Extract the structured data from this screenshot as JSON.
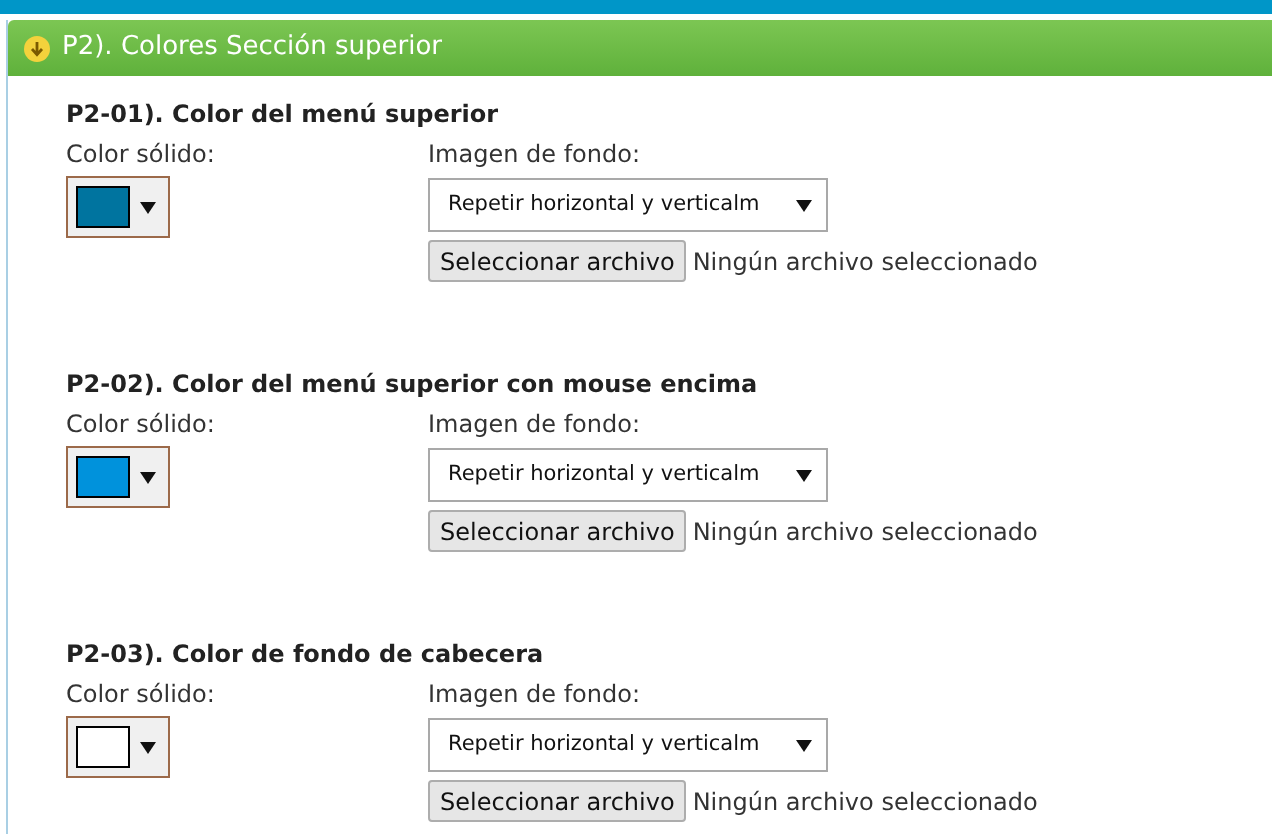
{
  "panel": {
    "title": "P2). Colores Sección superior",
    "expanded": true
  },
  "settings": [
    {
      "title": "P2-01). Color del menú superior",
      "color_label": "Color sólido:",
      "color": "#00749f",
      "image_label": "Imagen de fondo:",
      "repeat": "Repetir horizontal y verticalm",
      "file_button": "Seleccionar archivo",
      "file_status": "Ningún archivo seleccionado"
    },
    {
      "title": "P2-02). Color del menú superior con mouse encima",
      "color_label": "Color sólido:",
      "color": "#0092dc",
      "image_label": "Imagen de fondo:",
      "repeat": "Repetir horizontal y verticalm",
      "file_button": "Seleccionar archivo",
      "file_status": "Ningún archivo seleccionado"
    },
    {
      "title": "P2-03). Color de fondo de cabecera",
      "color_label": "Color sólido:",
      "color": "#ffffff",
      "image_label": "Imagen de fondo:",
      "repeat": "Repetir horizontal y verticalm",
      "file_button": "Seleccionar archivo",
      "file_status": "Ningún archivo seleccionado"
    }
  ]
}
